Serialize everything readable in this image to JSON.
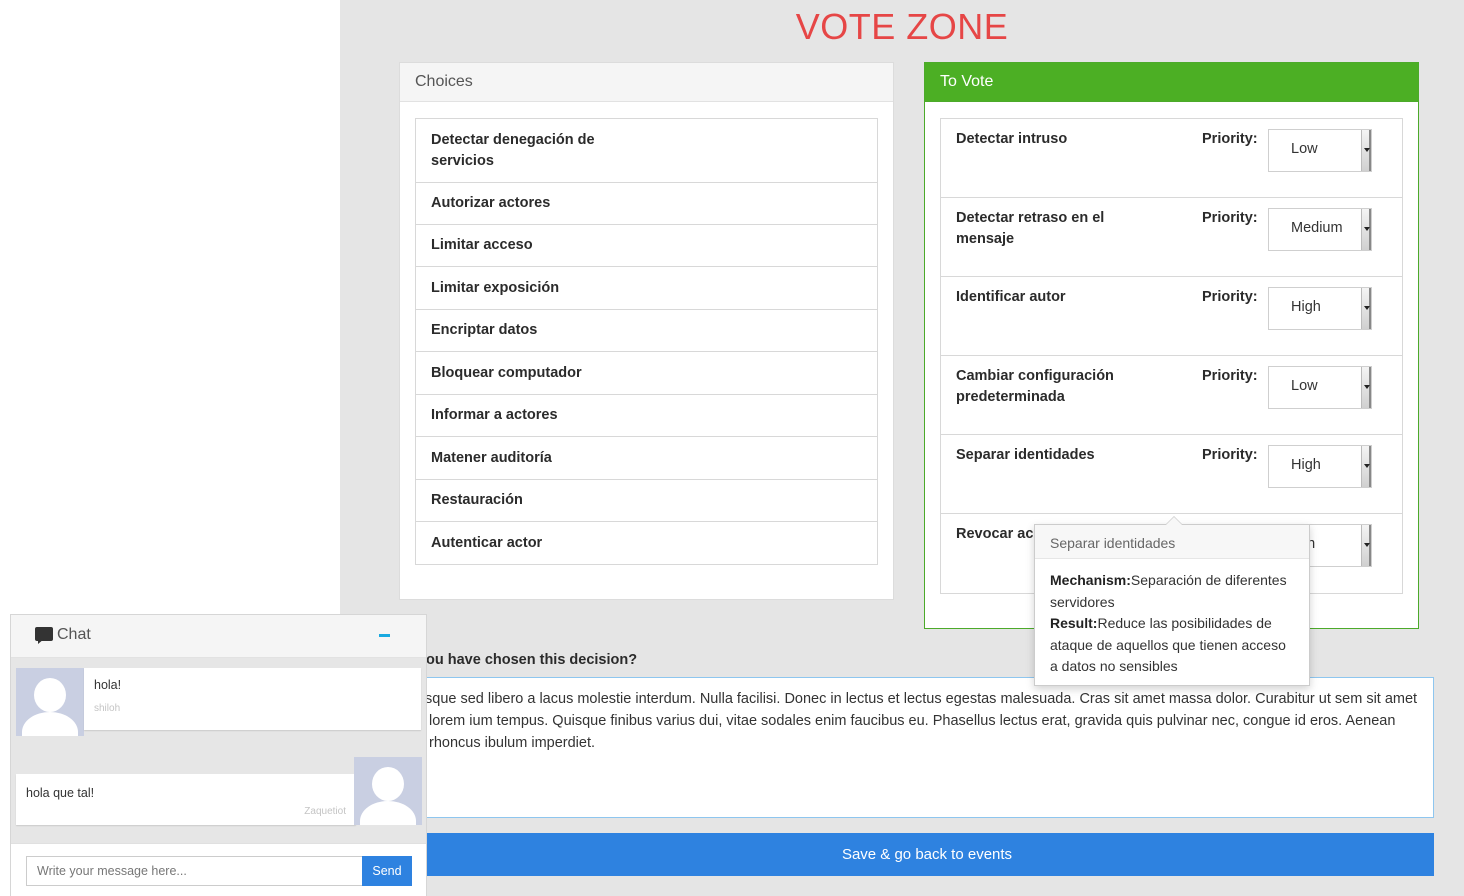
{
  "page": {
    "title": "VOTE ZONE"
  },
  "choices": {
    "header": "Choices",
    "items": [
      "Detectar denegación de servicios",
      "Autorizar actores",
      "Limitar acceso",
      "Limitar exposición",
      "Encriptar datos",
      "Bloquear computador",
      "Informar a actores",
      "Matener auditoría",
      "Restauración",
      "Autenticar actor"
    ]
  },
  "to_vote": {
    "header": "To Vote",
    "priority_label": "Priority:",
    "rows": [
      {
        "name": "Detectar intruso",
        "priority": "Low"
      },
      {
        "name": "Detectar retraso en el mensaje",
        "priority": "Medium"
      },
      {
        "name": "Identificar autor",
        "priority": "High"
      },
      {
        "name": "Cambiar configuración predeterminada",
        "priority": "Low"
      },
      {
        "name": "Separar identidades",
        "priority": "High"
      },
      {
        "name": "Revocar acc",
        "priority": "gh"
      }
    ]
  },
  "popover": {
    "title": "Separar identidades",
    "mechanism_label": "Mechanism:",
    "mechanism": "Separación de diferentes servidores",
    "result_label": "Result:",
    "result": "Reduce las posibilidades de ataque de aquellos que tienen acceso a datos no sensibles"
  },
  "decision": {
    "question": "ou have chosen this decision?",
    "reason_text": "sque sed libero a lacus molestie interdum. Nulla facilisi. Donec in lectus et lectus egestas malesuada. Cras sit amet massa dolor. Curabitur ut sem sit amet lorem ium tempus. Quisque finibus varius dui, vitae sodales enim faucibus eu. Phasellus lectus erat, gravida quis pulvinar nec, congue id eros. Aenean rhoncus ibulum imperdiet."
  },
  "save_button": "Save & go back to events",
  "chat": {
    "title": "Chat",
    "messages": [
      {
        "text": "hola!",
        "author": "shiloh"
      },
      {
        "text": "hola que tal!",
        "author": "Zaquetiot"
      }
    ],
    "input_placeholder": "Write your message here...",
    "send_label": "Send"
  }
}
